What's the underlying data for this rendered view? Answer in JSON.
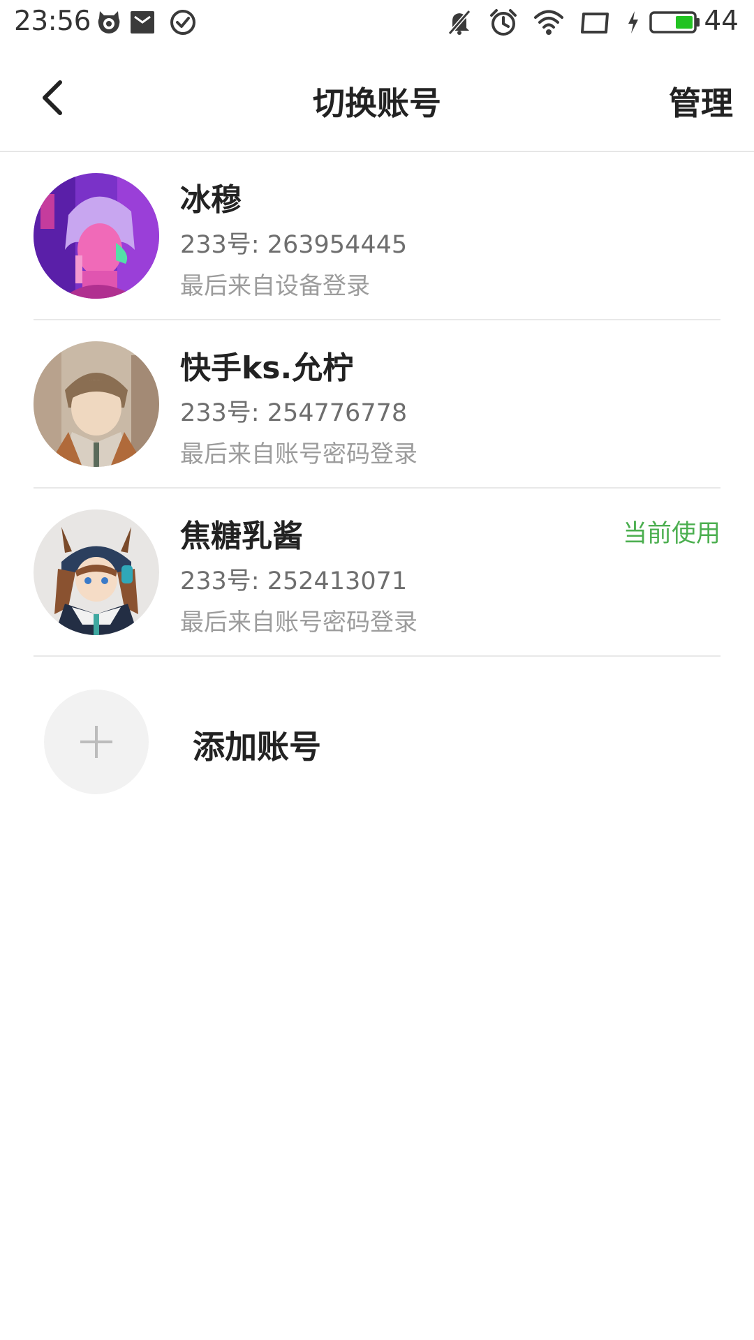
{
  "status_bar": {
    "time": "23:56",
    "left_icons": [
      "cat-notification-icon",
      "mail-notification-icon",
      "check-circle-icon"
    ],
    "right_icons": [
      "bell-muted-icon",
      "alarm-icon",
      "wifi-icon",
      "screen-rotation-icon",
      "charging-bolt-icon",
      "battery-icon"
    ],
    "battery_level": "44",
    "battery_color": "#22c322"
  },
  "nav": {
    "back_icon": "chevron-left-icon",
    "title": "切换账号",
    "manage": "管理"
  },
  "accounts": [
    {
      "name": "冰穆",
      "id_line": "233号: 263954445",
      "login_line": "最后来自设备登录",
      "current": ""
    },
    {
      "name": "快手ks.允柠",
      "id_line": "233号: 254776778",
      "login_line": "最后来自账号密码登录",
      "current": ""
    },
    {
      "name": "焦糖乳酱",
      "id_line": "233号: 252413071",
      "login_line": "最后来自账号密码登录",
      "current": "当前使用"
    }
  ],
  "add_account": {
    "label": "添加账号",
    "icon": "plus-icon"
  },
  "colors": {
    "current_badge": "#4caf50",
    "divider": "#e8e8e8"
  }
}
